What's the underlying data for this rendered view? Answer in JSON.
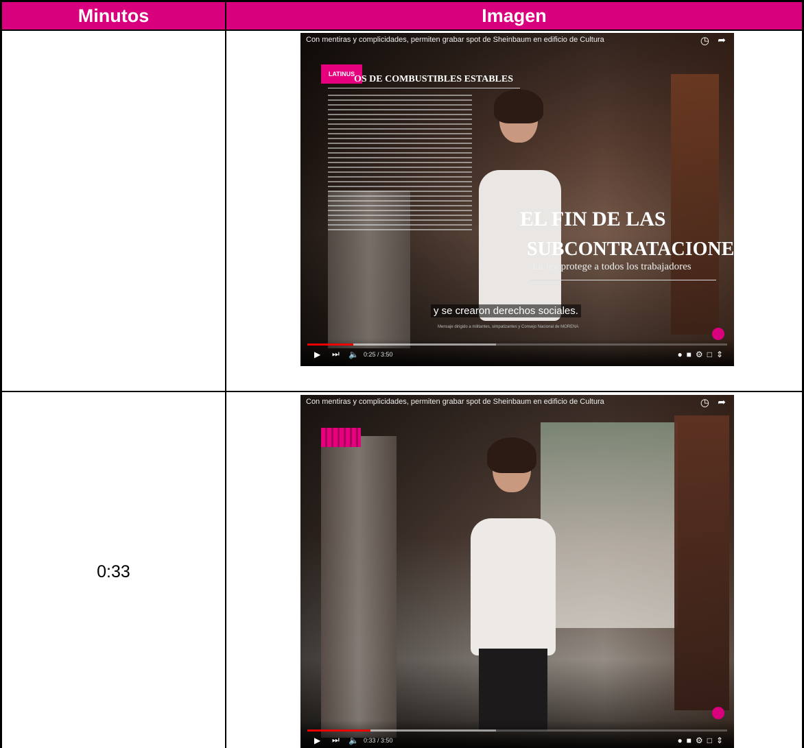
{
  "table": {
    "headers": [
      "Minutos",
      "Imagen"
    ],
    "header_color": "#d9007e",
    "rows": [
      {
        "minute": ""
      },
      {
        "minute": "0:33"
      }
    ]
  },
  "video1": {
    "title": "Con mentiras y complicidades, permiten grabar spot de Sheinbaum en edificio de Cultura",
    "logo": "LATINUS",
    "headline_top": "OS DE COMBUSTIBLES ESTABLES",
    "overlay_title_line1": "EL FIN DE LAS",
    "overlay_title_line2": "SUBCONTRATACIONES",
    "overlay_subtitle": "La ley protege a todos los trabajadores",
    "caption": "y se crearon derechos sociales.",
    "footer_note": "Mensaje dirigido a militantes, simpatizantes y Consejo Nacional de MORENA",
    "time": "0:25 / 3:50",
    "progress": 0.11,
    "buffered": 0.45
  },
  "video2": {
    "title": "Con mentiras y complicidades, permiten grabar spot de Sheinbaum en edificio de Cultura",
    "time": "0:33 / 3:50",
    "progress": 0.15,
    "buffered": 0.45
  },
  "icons": {
    "clock": "clock-icon",
    "share": "share-icon",
    "play": "play-icon",
    "next": "next-icon",
    "volume": "volume-icon"
  }
}
